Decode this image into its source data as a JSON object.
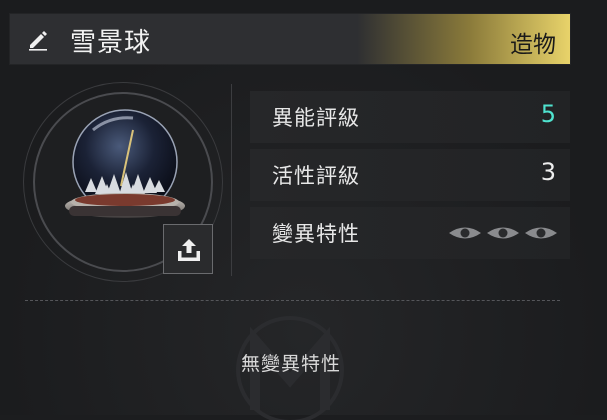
{
  "header": {
    "title": "雪景球",
    "type_label": "造物",
    "edit_icon": "pencil-icon"
  },
  "item": {
    "image_name": "snow-globe",
    "upload_icon": "upload-icon"
  },
  "stats": [
    {
      "label": "異能評級",
      "value": "5"
    },
    {
      "label": "活性評級",
      "value": "3"
    },
    {
      "label": "變異特性",
      "icon": "eye-icon",
      "icon_count": 3
    }
  ],
  "footer": {
    "text": "無變異特性"
  },
  "colors": {
    "accent": "#4fe3cf",
    "gold": "#e8d36a"
  }
}
